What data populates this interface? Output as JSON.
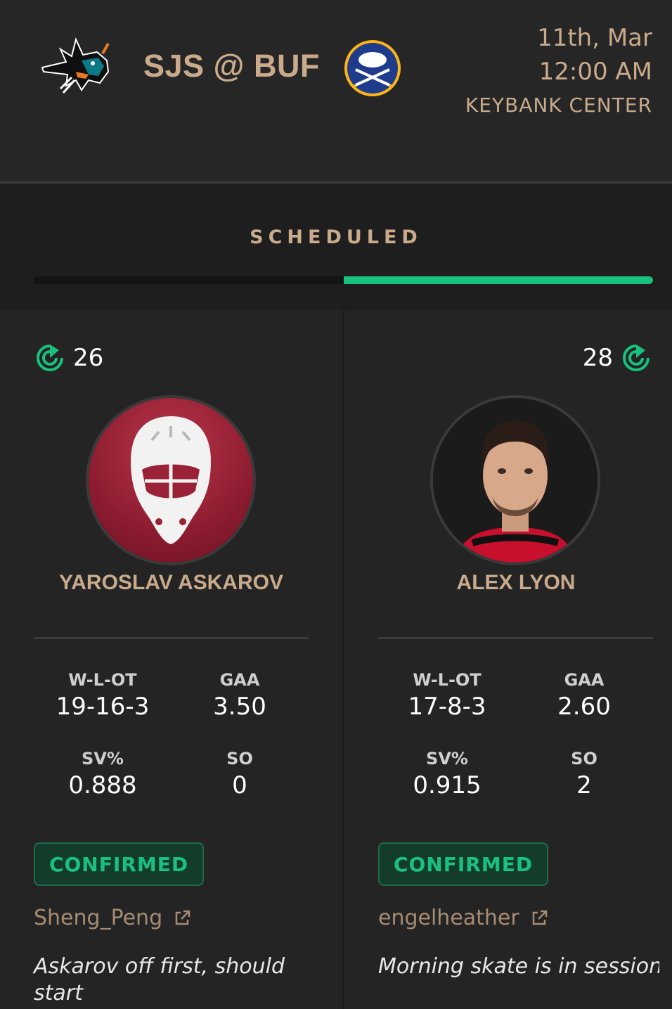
{
  "game": {
    "away_abbr": "SJS",
    "home_abbr": "BUF",
    "matchup": "SJS @ BUF",
    "date": "11th, Mar",
    "time": "12:00 AM",
    "venue": "KEYBANK CENTER",
    "away_logo_icon": "sharks-logo",
    "home_logo_icon": "sabres-logo"
  },
  "status": {
    "label": "SCHEDULED",
    "progress_fraction": 0.5,
    "accent_color": "#18c17e"
  },
  "goalies": [
    {
      "rank": "26",
      "rank_icon": "target-rank-icon",
      "name": "YAROSLAV ASKAROV",
      "avatar": "goalie-mask-placeholder",
      "stats": {
        "wlot_label": "W-L-OT",
        "wlot": "19-16-3",
        "gaa_label": "GAA",
        "gaa": "3.50",
        "svp_label": "SV%",
        "svp": "0.888",
        "so_label": "SO",
        "so": "0"
      },
      "status_badge": "CONFIRMED",
      "source": "Sheng_Peng",
      "note": "Askarov off first, should start"
    },
    {
      "rank": "28",
      "rank_icon": "target-rank-icon",
      "name": "ALEX LYON",
      "avatar": "player-photo",
      "stats": {
        "wlot_label": "W-L-OT",
        "wlot": "17-8-3",
        "gaa_label": "GAA",
        "gaa": "2.60",
        "svp_label": "SV%",
        "svp": "0.915",
        "so_label": "SO",
        "so": "2"
      },
      "status_badge": "CONFIRMED",
      "source": "engelheather",
      "note": "Morning skate is in session. Alex Lyon is in the starter'..."
    }
  ],
  "colors": {
    "background": "#242424",
    "gold": "#c9ab8c",
    "green": "#18c17e"
  }
}
